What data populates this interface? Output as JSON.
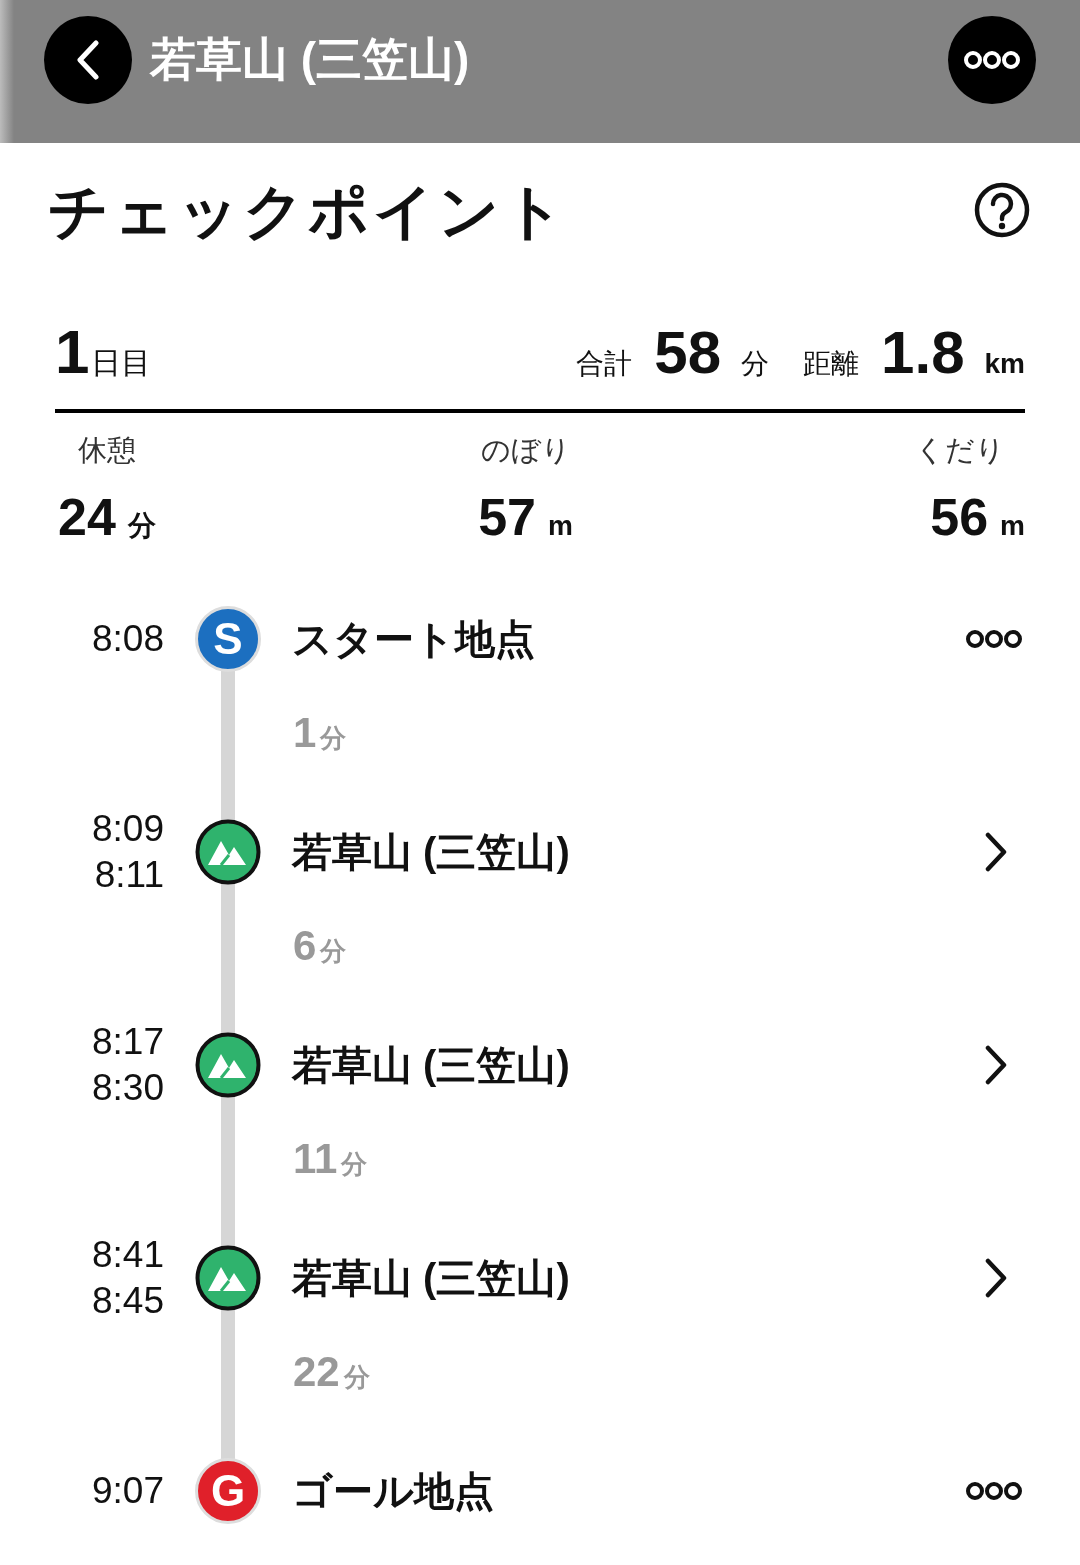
{
  "header": {
    "title": "若草山 (三笠山)"
  },
  "section": {
    "title": "チェックポイント"
  },
  "day": {
    "number": "1",
    "suffix": "日目",
    "total_label": "合計",
    "total_value": "58",
    "total_unit": "分",
    "distance_label": "距離",
    "distance_value": "1.8",
    "distance_unit": "km"
  },
  "stats": [
    {
      "label": "休憩",
      "value": "24",
      "unit": "分"
    },
    {
      "label": "のぼり",
      "value": "57",
      "unit": "m"
    },
    {
      "label": "くだり",
      "value": "56",
      "unit": "m"
    }
  ],
  "timeline": [
    {
      "kind": "start",
      "times": [
        "8:08"
      ],
      "badge": "S",
      "name": "スタート地点",
      "action": {
        "kind": "menu"
      }
    },
    {
      "kind": "duration",
      "value": "1",
      "unit": "分"
    },
    {
      "kind": "peak",
      "times": [
        "8:09",
        "8:11"
      ],
      "name": "若草山 (三笠山)",
      "action": {
        "kind": "chevron"
      }
    },
    {
      "kind": "duration",
      "value": "6",
      "unit": "分"
    },
    {
      "kind": "peak",
      "times": [
        "8:17",
        "8:30"
      ],
      "name": "若草山 (三笠山)",
      "action": {
        "kind": "chevron"
      }
    },
    {
      "kind": "duration",
      "value": "11",
      "unit": "分"
    },
    {
      "kind": "peak",
      "times": [
        "8:41",
        "8:45"
      ],
      "name": "若草山 (三笠山)",
      "action": {
        "kind": "chevron"
      }
    },
    {
      "kind": "duration",
      "value": "22",
      "unit": "分"
    },
    {
      "kind": "goal",
      "times": [
        "9:07"
      ],
      "badge": "G",
      "name": "ゴール地点",
      "action": {
        "kind": "menu"
      }
    }
  ]
}
